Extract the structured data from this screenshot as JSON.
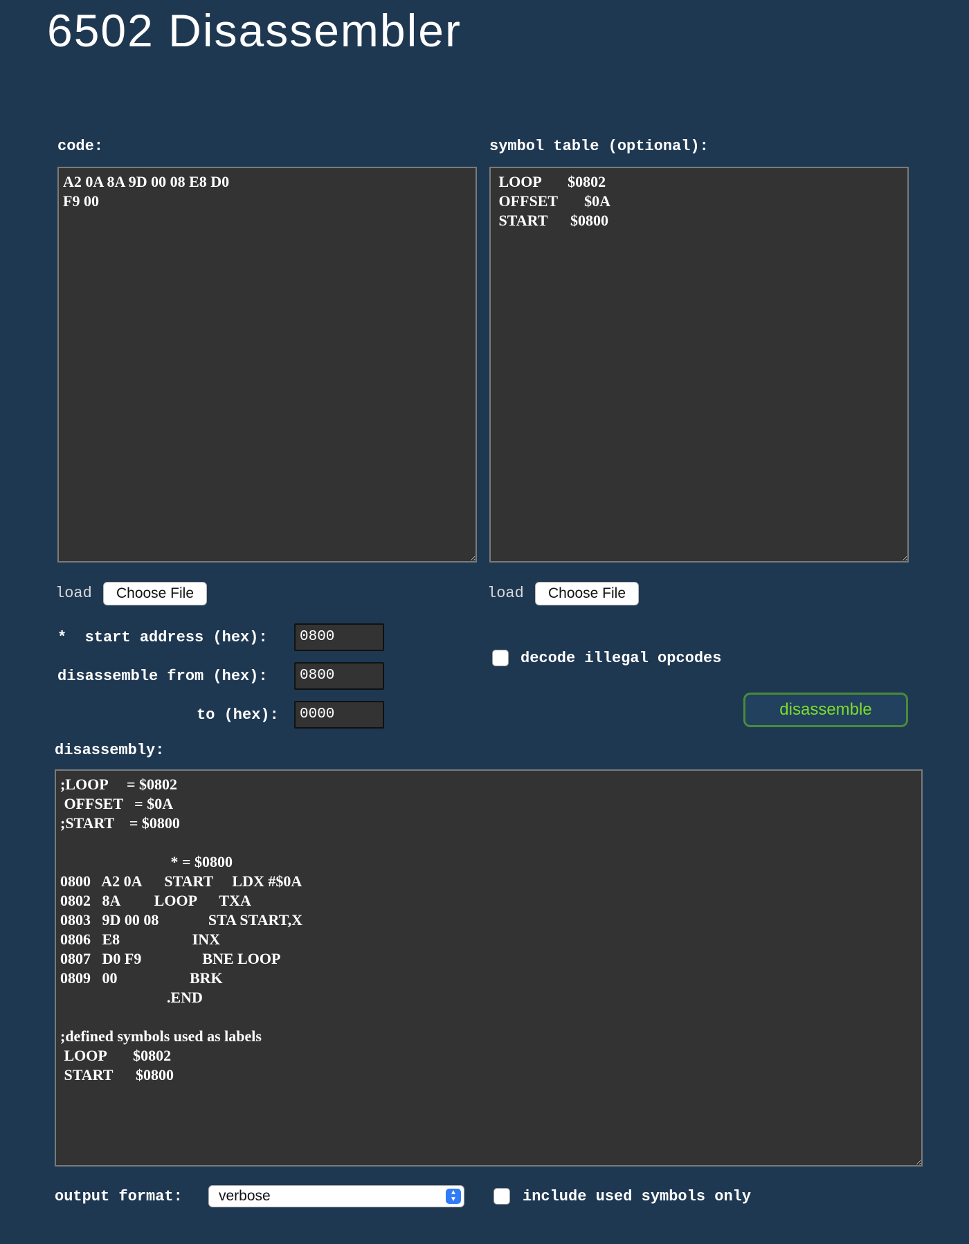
{
  "page_title": "6502 Disassembler",
  "code": {
    "label": "code:",
    "value": "A2 0A 8A 9D 00 08 E8 D0\nF9 00",
    "load_label": "load",
    "file_button": "Choose File"
  },
  "symbols": {
    "label": "symbol table (optional):",
    "value": " LOOP       $0802\n OFFSET       $0A\n START      $0800",
    "load_label": "load",
    "file_button": "Choose File"
  },
  "options": {
    "start_label": "*  start address (hex):",
    "start_value": "0800",
    "from_label": "disassemble from (hex):",
    "from_value": "0800",
    "to_label": "to (hex):",
    "to_value": "0000",
    "illegal_label": "decode illegal opcodes",
    "illegal_checked": false,
    "disassemble_button": "disassemble"
  },
  "disassembly": {
    "label": "disassembly:",
    "value": ";LOOP     = $0802\n OFFSET   = $0A\n;START    = $0800\n\n                             * = $0800\n0800   A2 0A      START     LDX #$0A\n0802   8A         LOOP      TXA\n0803   9D 00 08             STA START,X\n0806   E8                   INX\n0807   D0 F9                BNE LOOP\n0809   00                   BRK\n                            .END\n\n;defined symbols used as labels\n LOOP       $0802\n START      $0800"
  },
  "output": {
    "format_label": "output format:",
    "format_value": "verbose",
    "used_only_label": "include used symbols only",
    "used_only_checked": false
  },
  "colors": {
    "background": "#1f3852",
    "textarea_bg": "#333333",
    "button_text": "#7cdc2c",
    "button_border": "#4a8a3a"
  }
}
